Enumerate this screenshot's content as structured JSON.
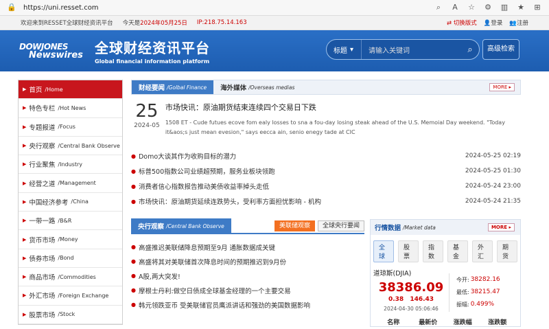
{
  "browser": {
    "url": "https://uni.resset.com"
  },
  "topbar": {
    "welcome": "欢迎来到RESSET全球财经资讯平台",
    "today_label": "今天是",
    "today": "2024年05月25日",
    "ip": "IP:218.75.14.163",
    "switch": "切换版式",
    "login": "登录",
    "register": "注册"
  },
  "header": {
    "logo_line1": "DOWJONES",
    "logo_line2": "Newswires",
    "title": "全球财经资讯平台",
    "subtitle": "Global financial information platform",
    "search_select": "标题",
    "search_placeholder": "请输入关键词",
    "advanced": "高级检索"
  },
  "sidebar": {
    "items": [
      {
        "cn": "首页",
        "en": "/Home"
      },
      {
        "cn": "特色专栏",
        "en": "/Hot News"
      },
      {
        "cn": "专题报道",
        "en": "/Focus"
      },
      {
        "cn": "央行观察",
        "en": "/Central Bank Observe"
      },
      {
        "cn": "行业聚焦",
        "en": "/Industry"
      },
      {
        "cn": "经营之道",
        "en": "/Management"
      },
      {
        "cn": "中国经济参考",
        "en": "/China"
      },
      {
        "cn": "一带一路",
        "en": "/B&R"
      },
      {
        "cn": "货币市场",
        "en": "/Money"
      },
      {
        "cn": "债券市场",
        "en": "/Bond"
      },
      {
        "cn": "商品市场",
        "en": "/Commodities"
      },
      {
        "cn": "外汇市场",
        "en": "/Foreign Exchange"
      },
      {
        "cn": "股票市场",
        "en": "/Stock"
      }
    ]
  },
  "news": {
    "tab1_cn": "财经要闻",
    "tab1_en": "/Golbal Finance",
    "tab2_cn": "海外媒体",
    "tab2_en": "/Overseas medias",
    "more": "MORE ▸",
    "feat_day": "25",
    "feat_ym": "2024-05",
    "feat_title": "市场快讯：原油期货结束连续四个交易日下跌",
    "feat_summary": "1508 ET - Cude futues ecove fom ealy losses to sna a fou-day losing steak ahead of the U.S. Memoial Day weekend. \"Today it&aos;s just mean evesion,\" says eecca ain, senio enegy tade at CIC",
    "items": [
      {
        "title": "Domo大谈其作为收购目标的潜力",
        "time": "2024-05-25 02:19"
      },
      {
        "title": "标普500指数公司业绩超预期，服务业板块领跑",
        "time": "2024-05-25 01:30"
      },
      {
        "title": "消费者信心指数报告推动美债收益率掉头走低",
        "time": "2024-05-24 23:00"
      },
      {
        "title": "市场快讯：原油期货延续连跌势头，受利率方面担忧影响 - 机构",
        "time": "2024-05-24 21:35"
      }
    ]
  },
  "cb": {
    "tab_cn": "央行观察",
    "tab_en": "/Central Bank Observe",
    "btn1": "美联储观察",
    "btn2": "全球央行要闻",
    "items": [
      {
        "title": "高盛推迟美联储降息预期至9月 通胀数据成关键"
      },
      {
        "title": "高盛将其对美联储首次降息时间的预期推迟到9月份"
      },
      {
        "title": "A股,两大突发!"
      },
      {
        "title": "摩根士丹利:做空日债成全球基金经理的一个主要交易"
      },
      {
        "title": "韩元领跌亚币 受美联储官员鹰派讲话和强劲的美国数据影响"
      }
    ]
  },
  "market": {
    "title_cn": "行情数据",
    "title_en": "/Market data",
    "more": "MORE ▸",
    "tabs": [
      "全球",
      "股票",
      "指数",
      "基金",
      "外汇",
      "期货"
    ],
    "index_name": "道琼斯(DJIA)",
    "value": "38386.09",
    "change": "0.38",
    "change_pct": "146.43",
    "time": "2024-04-30 05:06:46",
    "open_label": "今开:",
    "open": "38282.16",
    "low_label": "最低:",
    "low": "38215.47",
    "amp_label": "振幅:",
    "amp": "0.499%",
    "cols": [
      "名称",
      "最新价",
      "涨跌幅",
      "涨跌额"
    ],
    "colors": {
      "up": "#c00"
    }
  }
}
